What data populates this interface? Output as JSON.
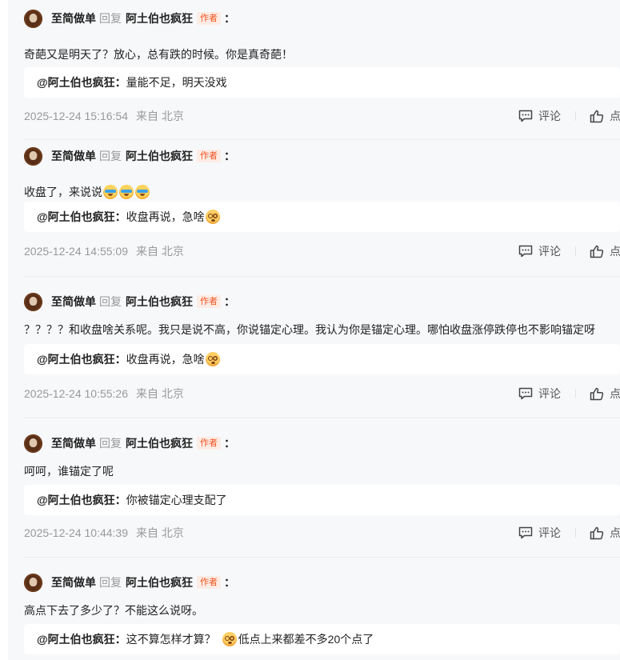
{
  "comments": [
    {
      "user": "至简做单",
      "reply_word": "回复",
      "target": "阿土伯也疯狂",
      "badge": "作者",
      "colon": "：",
      "text": "奇葩又是明天了？放心，总有跌的时候。你是真奇葩！",
      "text_emojis": [],
      "quote_name": "@阿土伯也疯狂：",
      "quote_text": "量能不足，明天没戏",
      "quote_emojis": [],
      "time": "2025-12-24 15:16:54",
      "location": "来自 北京",
      "comment_label": "评论",
      "like_label": "点"
    },
    {
      "user": "至简做单",
      "reply_word": "回复",
      "target": "阿土伯也疯狂",
      "badge": "作者",
      "colon": "：",
      "text": "收盘了，来说说",
      "text_emojis": [
        "crying-laughing-emoji",
        "crying-laughing-emoji",
        "crying-laughing-emoji"
      ],
      "quote_name": "@阿土伯也疯狂：",
      "quote_text": "收盘再说，急啥",
      "quote_emojis": [
        "dizzy-face-emoji"
      ],
      "time": "2025-12-24 14:55:09",
      "location": "来自 北京",
      "comment_label": "评论",
      "like_label": "点"
    },
    {
      "user": "至简做单",
      "reply_word": "回复",
      "target": "阿土伯也疯狂",
      "badge": "作者",
      "colon": "：",
      "text": "？？？？和收盘啥关系呢。我只是说不高，你说锚定心理。我认为你是锚定心理。哪怕收盘涨停跌停也不影响锚定呀",
      "text_emojis": [],
      "quote_name": "@阿土伯也疯狂：",
      "quote_text": "收盘再说，急啥",
      "quote_emojis": [
        "dizzy-face-emoji"
      ],
      "time": "2025-12-24 10:55:26",
      "location": "来自 北京",
      "comment_label": "评论",
      "like_label": "点"
    },
    {
      "user": "至简做单",
      "reply_word": "回复",
      "target": "阿土伯也疯狂",
      "badge": "作者",
      "colon": "：",
      "text": "呵呵，谁锚定了呢",
      "text_emojis": [],
      "quote_name": "@阿土伯也疯狂：",
      "quote_text": "你被锚定心理支配了",
      "quote_emojis": [],
      "time": "2025-12-24 10:44:39",
      "location": "来自 北京",
      "comment_label": "评论",
      "like_label": "点"
    },
    {
      "user": "至简做单",
      "reply_word": "回复",
      "target": "阿土伯也疯狂",
      "badge": "作者",
      "colon": "：",
      "text": "高点下去了多少了？不能这么说呀。",
      "text_emojis": [],
      "quote_name": "@阿土伯也疯狂：",
      "quote_text": "这不算怎样才算？",
      "quote_emojis": [
        "dizzy-face-emoji"
      ],
      "quote_text_after": "低点上来都差不多20个点了",
      "time": "",
      "location": "",
      "comment_label": "",
      "like_label": ""
    }
  ]
}
